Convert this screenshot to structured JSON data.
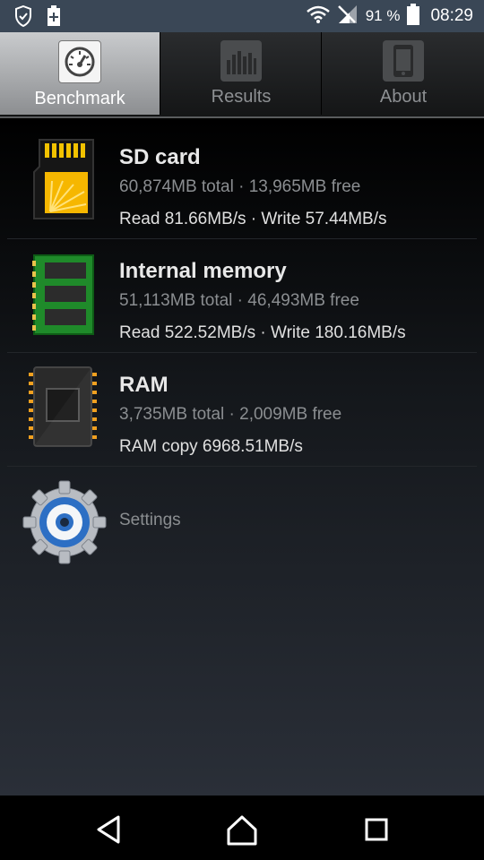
{
  "status": {
    "battery": "91 %",
    "time": "08:29"
  },
  "tabs": [
    {
      "label": "Benchmark",
      "icon": "speedometer-icon",
      "active": true
    },
    {
      "label": "Results",
      "icon": "bar-chart-icon",
      "active": false
    },
    {
      "label": "About",
      "icon": "phone-icon",
      "active": false
    }
  ],
  "items": [
    {
      "title": "SD card",
      "subtitle": "60,874MB total · 13,965MB free",
      "result": "Read 81.66MB/s · Write 57.44MB/s",
      "icon": "sd-card-icon"
    },
    {
      "title": "Internal memory",
      "subtitle": "51,113MB total · 46,493MB free",
      "result": "Read 522.52MB/s · Write 180.16MB/s",
      "icon": "memory-chip-icon"
    },
    {
      "title": "RAM",
      "subtitle": "3,735MB total · 2,009MB free",
      "result": "RAM copy 6968.51MB/s",
      "icon": "ram-chip-icon"
    }
  ],
  "settings": {
    "label": "Settings",
    "icon": "settings-gear-icon"
  },
  "nav": [
    "back-icon",
    "home-icon",
    "recents-icon"
  ]
}
